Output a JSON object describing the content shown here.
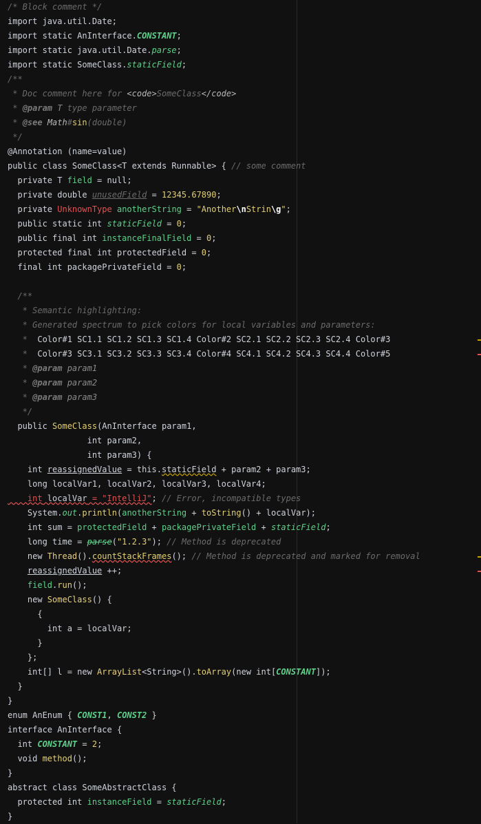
{
  "editor": {
    "lines": [
      [
        {
          "t": "/* Block comment */",
          "c": "c-comment"
        }
      ],
      [
        {
          "t": "import java.util.Date;"
        }
      ],
      [
        {
          "t": "import static AnInterface."
        },
        {
          "t": "CONSTANT",
          "c": "c-const"
        },
        {
          "t": ";"
        }
      ],
      [
        {
          "t": "import static java.util.Date."
        },
        {
          "t": "parse",
          "c": "c-static"
        },
        {
          "t": ";"
        }
      ],
      [
        {
          "t": "import static SomeClass."
        },
        {
          "t": "staticField",
          "c": "c-static"
        },
        {
          "t": ";"
        }
      ],
      [
        {
          "t": "/**",
          "c": "c-comment"
        }
      ],
      [
        {
          "t": " * Doc comment here for ",
          "c": "c-comment"
        },
        {
          "t": "<code>",
          "c": "c-docmarkup"
        },
        {
          "t": "SomeClass",
          "c": "c-comment"
        },
        {
          "t": "</code>",
          "c": "c-docmarkup"
        }
      ],
      [
        {
          "t": " * ",
          "c": "c-comment"
        },
        {
          "t": "@param",
          "c": "c-doctag"
        },
        {
          "t": " T",
          "c": "c-docparam"
        },
        {
          "t": " type parameter",
          "c": "c-comment"
        }
      ],
      [
        {
          "t": " * ",
          "c": "c-comment"
        },
        {
          "t": "@see",
          "c": "c-doctag"
        },
        {
          "t": " Math",
          "c": "c-docmarkup"
        },
        {
          "t": "#",
          "c": "c-comment"
        },
        {
          "t": "sin",
          "c": "c-method"
        },
        {
          "t": "(double)",
          "c": "c-comment"
        }
      ],
      [
        {
          "t": " */",
          "c": "c-comment"
        }
      ],
      [
        {
          "t": "@Annotation ("
        },
        {
          "t": "name=value"
        },
        {
          "t": ")"
        }
      ],
      [
        {
          "t": "public class SomeClass<T extends Runnable> { "
        },
        {
          "t": "// some comment",
          "c": "c-comment"
        }
      ],
      [
        {
          "t": "  private T "
        },
        {
          "t": "field",
          "c": "c-field"
        },
        {
          "t": " = null;"
        }
      ],
      [
        {
          "t": "  private double "
        },
        {
          "t": "unusedField",
          "c": "c-comment u-plain"
        },
        {
          "t": " = "
        },
        {
          "t": "12345.67890",
          "c": "c-num"
        },
        {
          "t": ";"
        }
      ],
      [
        {
          "t": "  private "
        },
        {
          "t": "UnknownType",
          "c": "c-unknown"
        },
        {
          "t": " "
        },
        {
          "t": "anotherString",
          "c": "c-field"
        },
        {
          "t": " = "
        },
        {
          "t": "\"Another",
          "c": "c-str"
        },
        {
          "t": "\\n",
          "c": "c-escape"
        },
        {
          "t": "Strin",
          "c": "c-str"
        },
        {
          "t": "\\g",
          "c": "c-escape"
        },
        {
          "t": "\"",
          "c": "c-str"
        },
        {
          "t": ";"
        }
      ],
      [
        {
          "t": "  public static int "
        },
        {
          "t": "staticField",
          "c": "c-static"
        },
        {
          "t": " = "
        },
        {
          "t": "0",
          "c": "c-num"
        },
        {
          "t": ";"
        }
      ],
      [
        {
          "t": "  public final int "
        },
        {
          "t": "instanceFinalField",
          "c": "c-field"
        },
        {
          "t": " = "
        },
        {
          "t": "0",
          "c": "c-num"
        },
        {
          "t": ";"
        }
      ],
      [
        {
          "t": "  protected final int "
        },
        {
          "t": "protectedField",
          "c": "c-kw"
        },
        {
          "t": " = "
        },
        {
          "t": "0",
          "c": "c-num"
        },
        {
          "t": ";"
        }
      ],
      [
        {
          "t": "  final int "
        },
        {
          "t": "packagePrivateField",
          "c": "c-kw"
        },
        {
          "t": " = "
        },
        {
          "t": "0",
          "c": "c-num"
        },
        {
          "t": ";"
        }
      ],
      [
        {
          "t": ""
        }
      ],
      [
        {
          "t": "  /**",
          "c": "c-comment"
        }
      ],
      [
        {
          "t": "   * Semantic highlighting:",
          "c": "c-comment"
        }
      ],
      [
        {
          "t": "   * Generated spectrum to pick colors for local variables and parameters:",
          "c": "c-comment"
        }
      ],
      [
        {
          "t": "   * ",
          "c": "c-comment"
        },
        {
          "t": " Color#1 SC1.1 SC1.2 SC1.3 SC1.4 Color#2 SC2.1 SC2.2 SC2.3 SC2.4 Color#3"
        }
      ],
      [
        {
          "t": "   * ",
          "c": "c-comment"
        },
        {
          "t": " Color#3 SC3.1 SC3.2 SC3.3 SC3.4 Color#4 SC4.1 SC4.2 SC4.3 SC4.4 Color#5"
        }
      ],
      [
        {
          "t": "   * ",
          "c": "c-comment"
        },
        {
          "t": "@param",
          "c": "c-doctag"
        },
        {
          "t": " param1",
          "c": "c-docparam"
        }
      ],
      [
        {
          "t": "   * ",
          "c": "c-comment"
        },
        {
          "t": "@param",
          "c": "c-doctag"
        },
        {
          "t": " param2",
          "c": "c-docparam"
        }
      ],
      [
        {
          "t": "   * ",
          "c": "c-comment"
        },
        {
          "t": "@param",
          "c": "c-doctag"
        },
        {
          "t": " param3",
          "c": "c-docparam"
        }
      ],
      [
        {
          "t": "   */",
          "c": "c-comment"
        }
      ],
      [
        {
          "t": "  public "
        },
        {
          "t": "SomeClass",
          "c": "c-method"
        },
        {
          "t": "(AnInterface param1,"
        }
      ],
      [
        {
          "t": "                int param2,"
        }
      ],
      [
        {
          "t": "                int param3) {"
        }
      ],
      [
        {
          "t": "    int "
        },
        {
          "t": "reassignedValue",
          "c": "u-plain"
        },
        {
          "t": " = this."
        },
        {
          "t": "staticField",
          "c": "u-warn"
        },
        {
          "t": " + param2 + param3;"
        }
      ],
      [
        {
          "t": "    long localVar1, localVar2, localVar3, localVar4;"
        }
      ],
      [
        {
          "t": "    int",
          "c": "c-err u-err"
        },
        {
          "t": " localVar",
          "c": "u-err"
        },
        {
          "t": " = \"IntelliJ\"",
          "c": "c-err u-err"
        },
        {
          "t": "; "
        },
        {
          "t": "// Error, incompatible types",
          "c": "c-comment"
        }
      ],
      [
        {
          "t": "    System."
        },
        {
          "t": "out",
          "c": "c-static"
        },
        {
          "t": "."
        },
        {
          "t": "println",
          "c": "c-method"
        },
        {
          "t": "("
        },
        {
          "t": "anotherString",
          "c": "c-field"
        },
        {
          "t": " + "
        },
        {
          "t": "toString",
          "c": "c-method"
        },
        {
          "t": "() + localVar);"
        }
      ],
      [
        {
          "t": "    int sum = "
        },
        {
          "t": "protectedField",
          "c": "c-field"
        },
        {
          "t": " + "
        },
        {
          "t": "packagePrivateField",
          "c": "c-field"
        },
        {
          "t": " + "
        },
        {
          "t": "staticField",
          "c": "c-static"
        },
        {
          "t": ";"
        }
      ],
      [
        {
          "t": "    long time = "
        },
        {
          "t": "parse",
          "c": "c-static strike"
        },
        {
          "t": "("
        },
        {
          "t": "\"1.2.3\"",
          "c": "c-str"
        },
        {
          "t": "); "
        },
        {
          "t": "// Method is deprecated",
          "c": "c-comment"
        }
      ],
      [
        {
          "t": "    new "
        },
        {
          "t": "Thread",
          "c": "c-class"
        },
        {
          "t": "()."
        },
        {
          "t": "countStackFrames",
          "c": "c-method u-err"
        },
        {
          "t": "(); "
        },
        {
          "t": "// Method is deprecated and marked for removal",
          "c": "c-comment"
        }
      ],
      [
        {
          "t": "    "
        },
        {
          "t": "reassignedValue",
          "c": "u-plain"
        },
        {
          "t": " ++;"
        }
      ],
      [
        {
          "t": "    "
        },
        {
          "t": "field",
          "c": "c-field"
        },
        {
          "t": "."
        },
        {
          "t": "run",
          "c": "c-method"
        },
        {
          "t": "();"
        }
      ],
      [
        {
          "t": "    new "
        },
        {
          "t": "SomeClass",
          "c": "c-class"
        },
        {
          "t": "() {"
        }
      ],
      [
        {
          "t": "      {"
        }
      ],
      [
        {
          "t": "        int a = localVar;"
        }
      ],
      [
        {
          "t": "      }"
        }
      ],
      [
        {
          "t": "    };"
        }
      ],
      [
        {
          "t": "    int[] l = new "
        },
        {
          "t": "ArrayList",
          "c": "c-class"
        },
        {
          "t": "<String>()."
        },
        {
          "t": "toArray",
          "c": "c-method"
        },
        {
          "t": "(new int["
        },
        {
          "t": "CONSTANT",
          "c": "c-const"
        },
        {
          "t": "]);"
        }
      ],
      [
        {
          "t": "  }"
        }
      ],
      [
        {
          "t": "}"
        }
      ],
      [
        {
          "t": "enum AnEnum { "
        },
        {
          "t": "CONST1",
          "c": "c-const"
        },
        {
          "t": ", "
        },
        {
          "t": "CONST2",
          "c": "c-const"
        },
        {
          "t": " }"
        }
      ],
      [
        {
          "t": "interface AnInterface {"
        }
      ],
      [
        {
          "t": "  int "
        },
        {
          "t": "CONSTANT",
          "c": "c-const"
        },
        {
          "t": " = "
        },
        {
          "t": "2",
          "c": "c-num"
        },
        {
          "t": ";"
        }
      ],
      [
        {
          "t": "  void "
        },
        {
          "t": "method",
          "c": "c-method"
        },
        {
          "t": "();"
        }
      ],
      [
        {
          "t": "}"
        }
      ],
      [
        {
          "t": "abstract class SomeAbstractClass {"
        }
      ],
      [
        {
          "t": "  protected int "
        },
        {
          "t": "instanceField",
          "c": "c-field"
        },
        {
          "t": " = "
        },
        {
          "t": "staticField",
          "c": "c-static"
        },
        {
          "t": ";"
        }
      ],
      [
        {
          "t": "}"
        }
      ]
    ]
  },
  "stripes": [
    {
      "line": 23,
      "color": "#c8a200"
    },
    {
      "line": 24,
      "color": "#e05252"
    },
    {
      "line": 38,
      "color": "#c8a200"
    },
    {
      "line": 39,
      "color": "#e05252"
    }
  ]
}
